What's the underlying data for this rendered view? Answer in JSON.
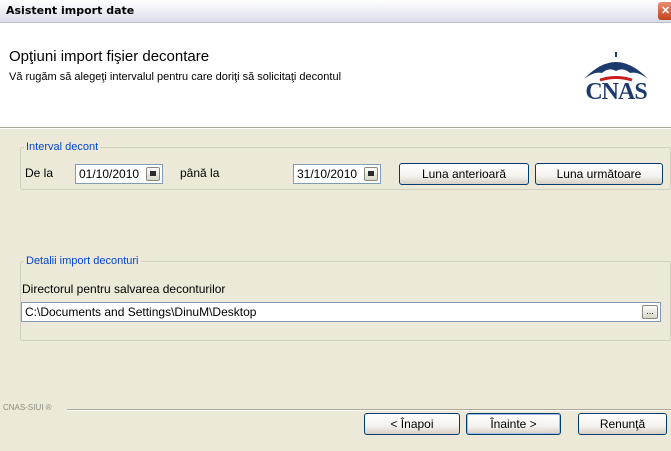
{
  "window": {
    "title": "Asistent import date"
  },
  "header": {
    "title": "Opţiuni import fişier decontare",
    "subtitle": "Vă rugăm să alegeţi intervalul pentru care doriţi să solicitaţi decontul",
    "logo_text": "CNAS"
  },
  "interval": {
    "legend": "Interval decont",
    "from_label": "De la",
    "from_value": "01/10/2010",
    "to_label": "până la",
    "to_value": "31/10/2010",
    "prev_month_button": "Luna anterioară",
    "next_month_button": "Luna următoare"
  },
  "import_details": {
    "legend": "Detalii import deconturi",
    "dir_label": "Directorul pentru salvarea deconturilor",
    "dir_value": "C:\\Documents and Settings\\DinuM\\Desktop",
    "browse_label": "..."
  },
  "footer": {
    "brand": "CNAS-SIUI ®",
    "back_button": "< Înapoi",
    "next_button": "Înainte >",
    "cancel_button": "Renunţă"
  },
  "colors": {
    "legend": "#0046d5",
    "window_bg": "#ece9d8",
    "button_border": "#003c74"
  }
}
